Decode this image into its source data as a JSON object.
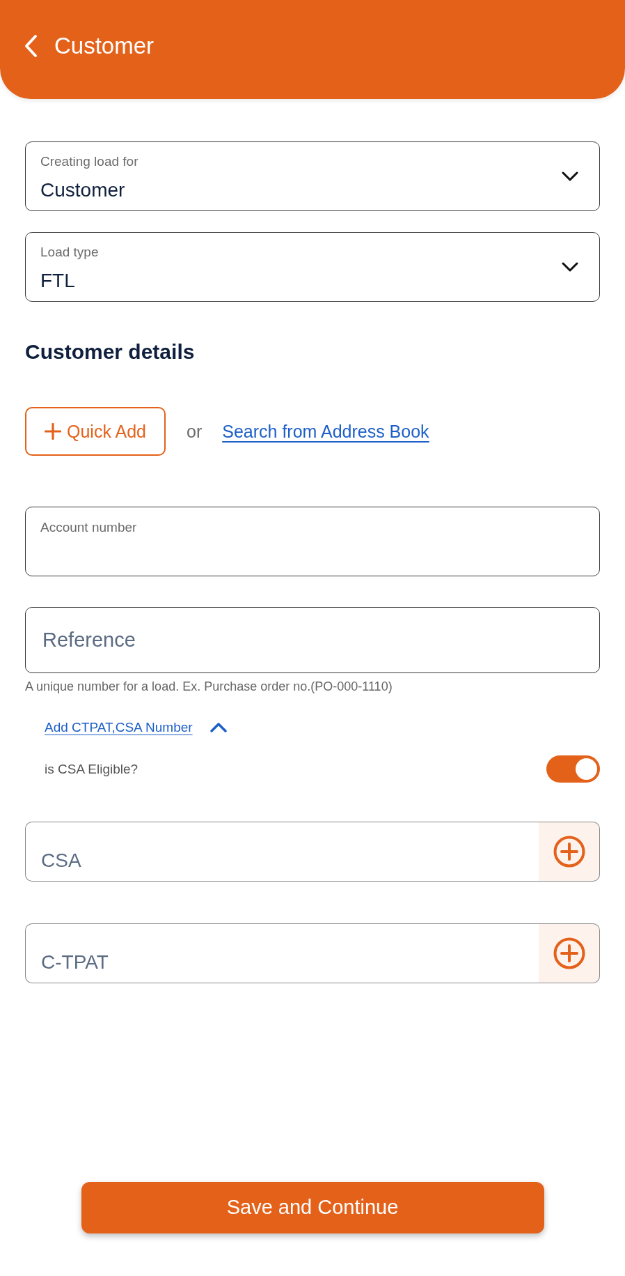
{
  "header": {
    "title": "Customer"
  },
  "dropdowns": [
    {
      "label": "Creating load for",
      "value": "Customer"
    },
    {
      "label": "Load type",
      "value": "FTL"
    }
  ],
  "customer_details": {
    "heading": "Customer details",
    "quick_add_button": "Quick Add",
    "separator": "or",
    "address_book_link": "Search from Address Book",
    "account_number": {
      "label": "Account number"
    },
    "reference": {
      "placeholder": "Reference",
      "helper": "A unique number for a load. Ex. Purchase order no.(PO-000-1110)"
    }
  },
  "ctpat_section": {
    "toggle_link": "Add CTPAT,CSA Number",
    "expanded": true,
    "csa_eligible": {
      "label": "is CSA Eligible?",
      "on": true
    },
    "number_fields": [
      {
        "placeholder": "CSA"
      },
      {
        "placeholder": "C-TPAT"
      }
    ]
  },
  "save_button": "Save and Continue"
}
